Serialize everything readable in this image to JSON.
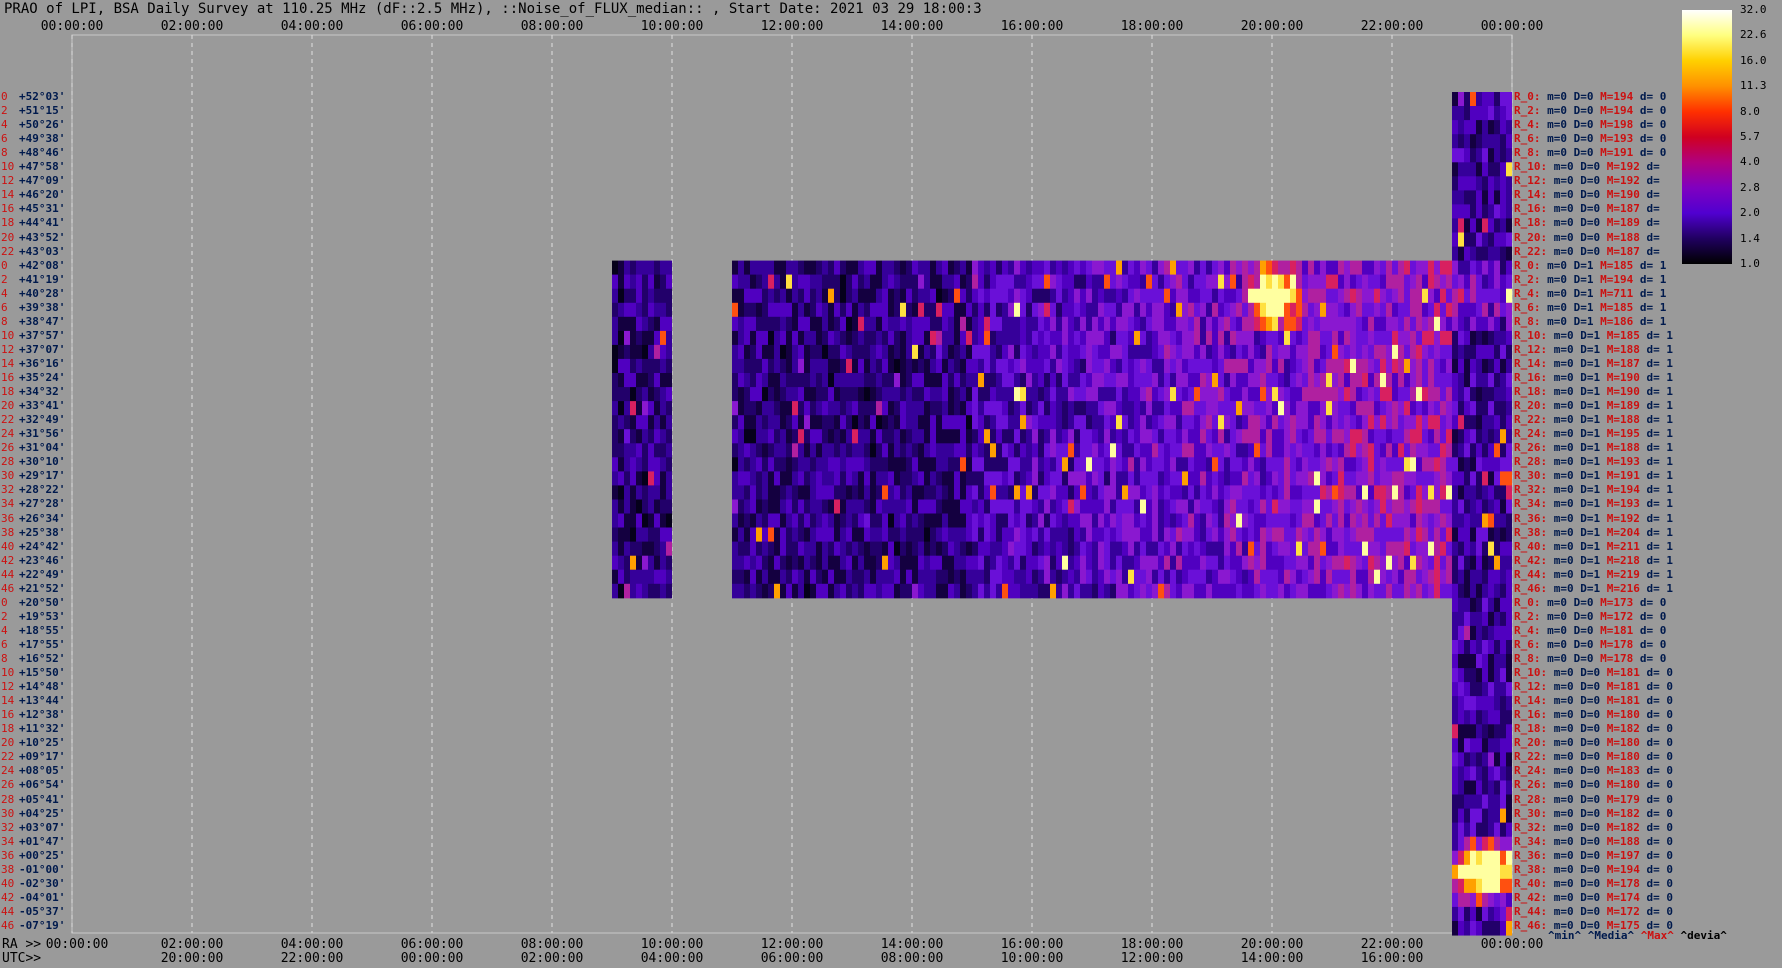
{
  "title": "PRAO of LPI, BSA Daily Survey at 110.25 MHz (dF::2.5 MHz), ::Noise_of_FLUX_median:: , Start Date: 2021 03 29 18:00:3",
  "ra_label": "RA >>",
  "utc_label": "UTC>>",
  "chart_data": {
    "type": "heatmap",
    "title": "PRAO of LPI, BSA Daily Survey at 110.25 MHz (dF::2.5 MHz), ::Noise_of_FLUX_median:: , Start Date: 2021 03 29 18:00:3",
    "x_top_ticks": [
      "00:00:00",
      "02:00:00",
      "04:00:00",
      "06:00:00",
      "08:00:00",
      "10:00:00",
      "12:00:00",
      "14:00:00",
      "16:00:00",
      "18:00:00",
      "20:00:00",
      "22:00:00",
      "00:00:00"
    ],
    "x_ra_ticks": [
      "00:00:00",
      "02:00:00",
      "04:00:00",
      "06:00:00",
      "08:00:00",
      "10:00:00",
      "12:00:00",
      "14:00:00",
      "16:00:00",
      "18:00:00",
      "20:00:00",
      "22:00:00",
      "00:00:00"
    ],
    "x_utc_ticks": [
      "20:00:00",
      "22:00:00",
      "00:00:00",
      "02:00:00",
      "04:00:00",
      "06:00:00",
      "08:00:00",
      "10:00:00",
      "12:00:00",
      "14:00:00",
      "16:00:00"
    ],
    "xlim_hours": [
      0,
      24
    ],
    "declinations": [
      "+52°03'",
      "+51°15'",
      "+50°26'",
      "+49°38'",
      "+48°46'",
      "+47°58'",
      "+47°09'",
      "+46°20'",
      "+45°31'",
      "+44°41'",
      "+43°52'",
      "+43°03'",
      "+42°08'",
      "+41°19'",
      "+40°28'",
      "+39°38'",
      "+38°47'",
      "+37°57'",
      "+37°07'",
      "+36°16'",
      "+35°24'",
      "+34°32'",
      "+33°41'",
      "+32°49'",
      "+31°56'",
      "+31°04'",
      "+30°10'",
      "+29°17'",
      "+28°22'",
      "+27°28'",
      "+26°34'",
      "+25°38'",
      "+24°42'",
      "+23°46'",
      "+22°49'",
      "+21°52'",
      "+20°50'",
      "+19°53'",
      "+18°55'",
      "+17°55'",
      "+16°52'",
      "+15°50'",
      "+14°48'",
      "+13°44'",
      "+12°38'",
      "+11°32'",
      "+10°25'",
      "+09°17'",
      "+08°05'",
      "+06°54'",
      "+05°41'",
      "+04°25'",
      "+03°07'",
      "+01°47'",
      "+00°25'",
      "-01°00'",
      "-02°30'",
      "-04°01'",
      "-05°37'",
      "-07°19'"
    ],
    "row_indices": [
      "0",
      "2",
      "4",
      "6",
      "8",
      "10",
      "12",
      "14",
      "16",
      "18",
      "20",
      "22",
      "0",
      "2",
      "4",
      "6",
      "8",
      "10",
      "12",
      "14",
      "16",
      "18",
      "20",
      "22",
      "24",
      "26",
      "28",
      "30",
      "32",
      "34",
      "36",
      "38",
      "40",
      "42",
      "44",
      "46",
      "0",
      "2",
      "4",
      "6",
      "8",
      "10",
      "12",
      "14",
      "16",
      "18",
      "20",
      "22",
      "24",
      "26",
      "28",
      "30",
      "32",
      "34",
      "36",
      "38",
      "40",
      "42",
      "44",
      "46"
    ],
    "filled_blocks": [
      {
        "ra_start": 9.0,
        "ra_end": 10.0,
        "row_start": 12,
        "row_end": 36
      },
      {
        "ra_start": 11.0,
        "ra_end": 23.0,
        "row_start": 12,
        "row_end": 36
      },
      {
        "ra_start": 23.0,
        "ra_end": 24.0,
        "row_start": 0,
        "row_end": 60
      }
    ],
    "hotspots": [
      {
        "ra": 20.0,
        "row": 14,
        "label": "bright source"
      },
      {
        "ra": 23.5,
        "row": 55,
        "label": "bright band"
      }
    ],
    "colorscale": {
      "ticks": [
        "32.0",
        "22.6",
        "16.0",
        "11.3",
        "8.0",
        "5.7",
        "4.0",
        "2.8",
        "2.0",
        "1.4",
        "1.0"
      ],
      "colors": [
        "#ffffff",
        "#ffff80",
        "#ffd000",
        "#ff9000",
        "#ff3000",
        "#d00020",
        "#b00080",
        "#8000c0",
        "#5000d0",
        "#200060",
        "#000000"
      ]
    },
    "stats": [
      {
        "r": "R_0:",
        "m": "0",
        "D": "0",
        "M": "194",
        "d": "0"
      },
      {
        "r": "R_2:",
        "m": "0",
        "D": "0",
        "M": "194",
        "d": "0"
      },
      {
        "r": "R_4:",
        "m": "0",
        "D": "0",
        "M": "198",
        "d": "0"
      },
      {
        "r": "R_6:",
        "m": "0",
        "D": "0",
        "M": "193",
        "d": "0"
      },
      {
        "r": "R_8:",
        "m": "0",
        "D": "0",
        "M": "191",
        "d": "0"
      },
      {
        "r": "R_10:",
        "m": "0",
        "D": "0",
        "M": "192",
        "d": ""
      },
      {
        "r": "R_12:",
        "m": "0",
        "D": "0",
        "M": "192",
        "d": ""
      },
      {
        "r": "R_14:",
        "m": "0",
        "D": "0",
        "M": "190",
        "d": ""
      },
      {
        "r": "R_16:",
        "m": "0",
        "D": "0",
        "M": "187",
        "d": ""
      },
      {
        "r": "R_18:",
        "m": "0",
        "D": "0",
        "M": "189",
        "d": ""
      },
      {
        "r": "R_20:",
        "m": "0",
        "D": "0",
        "M": "188",
        "d": ""
      },
      {
        "r": "R_22:",
        "m": "0",
        "D": "0",
        "M": "187",
        "d": ""
      },
      {
        "r": "R_0:",
        "m": "0",
        "D": "1",
        "M": "185",
        "d": "1"
      },
      {
        "r": "R_2:",
        "m": "0",
        "D": "1",
        "M": "194",
        "d": "1"
      },
      {
        "r": "R_4:",
        "m": "0",
        "D": "1",
        "M": "711",
        "d": "1"
      },
      {
        "r": "R_6:",
        "m": "0",
        "D": "1",
        "M": "185",
        "d": "1"
      },
      {
        "r": "R_8:",
        "m": "0",
        "D": "1",
        "M": "186",
        "d": "1"
      },
      {
        "r": "R_10:",
        "m": "0",
        "D": "1",
        "M": "185",
        "d": "1"
      },
      {
        "r": "R_12:",
        "m": "0",
        "D": "1",
        "M": "188",
        "d": "1"
      },
      {
        "r": "R_14:",
        "m": "0",
        "D": "1",
        "M": "187",
        "d": "1"
      },
      {
        "r": "R_16:",
        "m": "0",
        "D": "1",
        "M": "190",
        "d": "1"
      },
      {
        "r": "R_18:",
        "m": "0",
        "D": "1",
        "M": "190",
        "d": "1"
      },
      {
        "r": "R_20:",
        "m": "0",
        "D": "1",
        "M": "189",
        "d": "1"
      },
      {
        "r": "R_22:",
        "m": "0",
        "D": "1",
        "M": "188",
        "d": "1"
      },
      {
        "r": "R_24:",
        "m": "0",
        "D": "1",
        "M": "195",
        "d": "1"
      },
      {
        "r": "R_26:",
        "m": "0",
        "D": "1",
        "M": "188",
        "d": "1"
      },
      {
        "r": "R_28:",
        "m": "0",
        "D": "1",
        "M": "193",
        "d": "1"
      },
      {
        "r": "R_30:",
        "m": "0",
        "D": "1",
        "M": "191",
        "d": "1"
      },
      {
        "r": "R_32:",
        "m": "0",
        "D": "1",
        "M": "194",
        "d": "1"
      },
      {
        "r": "R_34:",
        "m": "0",
        "D": "1",
        "M": "193",
        "d": "1"
      },
      {
        "r": "R_36:",
        "m": "0",
        "D": "1",
        "M": "192",
        "d": "1"
      },
      {
        "r": "R_38:",
        "m": "0",
        "D": "1",
        "M": "204",
        "d": "1"
      },
      {
        "r": "R_40:",
        "m": "0",
        "D": "1",
        "M": "211",
        "d": "1"
      },
      {
        "r": "R_42:",
        "m": "0",
        "D": "1",
        "M": "218",
        "d": "1"
      },
      {
        "r": "R_44:",
        "m": "0",
        "D": "1",
        "M": "219",
        "d": "1"
      },
      {
        "r": "R_46:",
        "m": "0",
        "D": "1",
        "M": "216",
        "d": "1"
      },
      {
        "r": "R_0:",
        "m": "0",
        "D": "0",
        "M": "173",
        "d": "0"
      },
      {
        "r": "R_2:",
        "m": "0",
        "D": "0",
        "M": "172",
        "d": "0"
      },
      {
        "r": "R_4:",
        "m": "0",
        "D": "0",
        "M": "181",
        "d": "0"
      },
      {
        "r": "R_6:",
        "m": "0",
        "D": "0",
        "M": "178",
        "d": "0"
      },
      {
        "r": "R_8:",
        "m": "0",
        "D": "0",
        "M": "178",
        "d": "0"
      },
      {
        "r": "R_10:",
        "m": "0",
        "D": "0",
        "M": "181",
        "d": "0"
      },
      {
        "r": "R_12:",
        "m": "0",
        "D": "0",
        "M": "181",
        "d": "0"
      },
      {
        "r": "R_14:",
        "m": "0",
        "D": "0",
        "M": "181",
        "d": "0"
      },
      {
        "r": "R_16:",
        "m": "0",
        "D": "0",
        "M": "180",
        "d": "0"
      },
      {
        "r": "R_18:",
        "m": "0",
        "D": "0",
        "M": "182",
        "d": "0"
      },
      {
        "r": "R_20:",
        "m": "0",
        "D": "0",
        "M": "180",
        "d": "0"
      },
      {
        "r": "R_22:",
        "m": "0",
        "D": "0",
        "M": "180",
        "d": "0"
      },
      {
        "r": "R_24:",
        "m": "0",
        "D": "0",
        "M": "183",
        "d": "0"
      },
      {
        "r": "R_26:",
        "m": "0",
        "D": "0",
        "M": "180",
        "d": "0"
      },
      {
        "r": "R_28:",
        "m": "0",
        "D": "0",
        "M": "179",
        "d": "0"
      },
      {
        "r": "R_30:",
        "m": "0",
        "D": "0",
        "M": "182",
        "d": "0"
      },
      {
        "r": "R_32:",
        "m": "0",
        "D": "0",
        "M": "182",
        "d": "0"
      },
      {
        "r": "R_34:",
        "m": "0",
        "D": "0",
        "M": "188",
        "d": "0"
      },
      {
        "r": "R_36:",
        "m": "0",
        "D": "0",
        "M": "197",
        "d": "0"
      },
      {
        "r": "R_38:",
        "m": "0",
        "D": "0",
        "M": "194",
        "d": "0"
      },
      {
        "r": "R_40:",
        "m": "0",
        "D": "0",
        "M": "178",
        "d": "0"
      },
      {
        "r": "R_42:",
        "m": "0",
        "D": "0",
        "M": "174",
        "d": "0"
      },
      {
        "r": "R_44:",
        "m": "0",
        "D": "0",
        "M": "172",
        "d": "0"
      },
      {
        "r": "R_46:",
        "m": "0",
        "D": "0",
        "M": "175",
        "d": "0"
      }
    ],
    "legend": {
      "min": "^min^",
      "median": "^Media^",
      "max": "^Max^",
      "devia": "^devia^"
    },
    "grid": true
  }
}
